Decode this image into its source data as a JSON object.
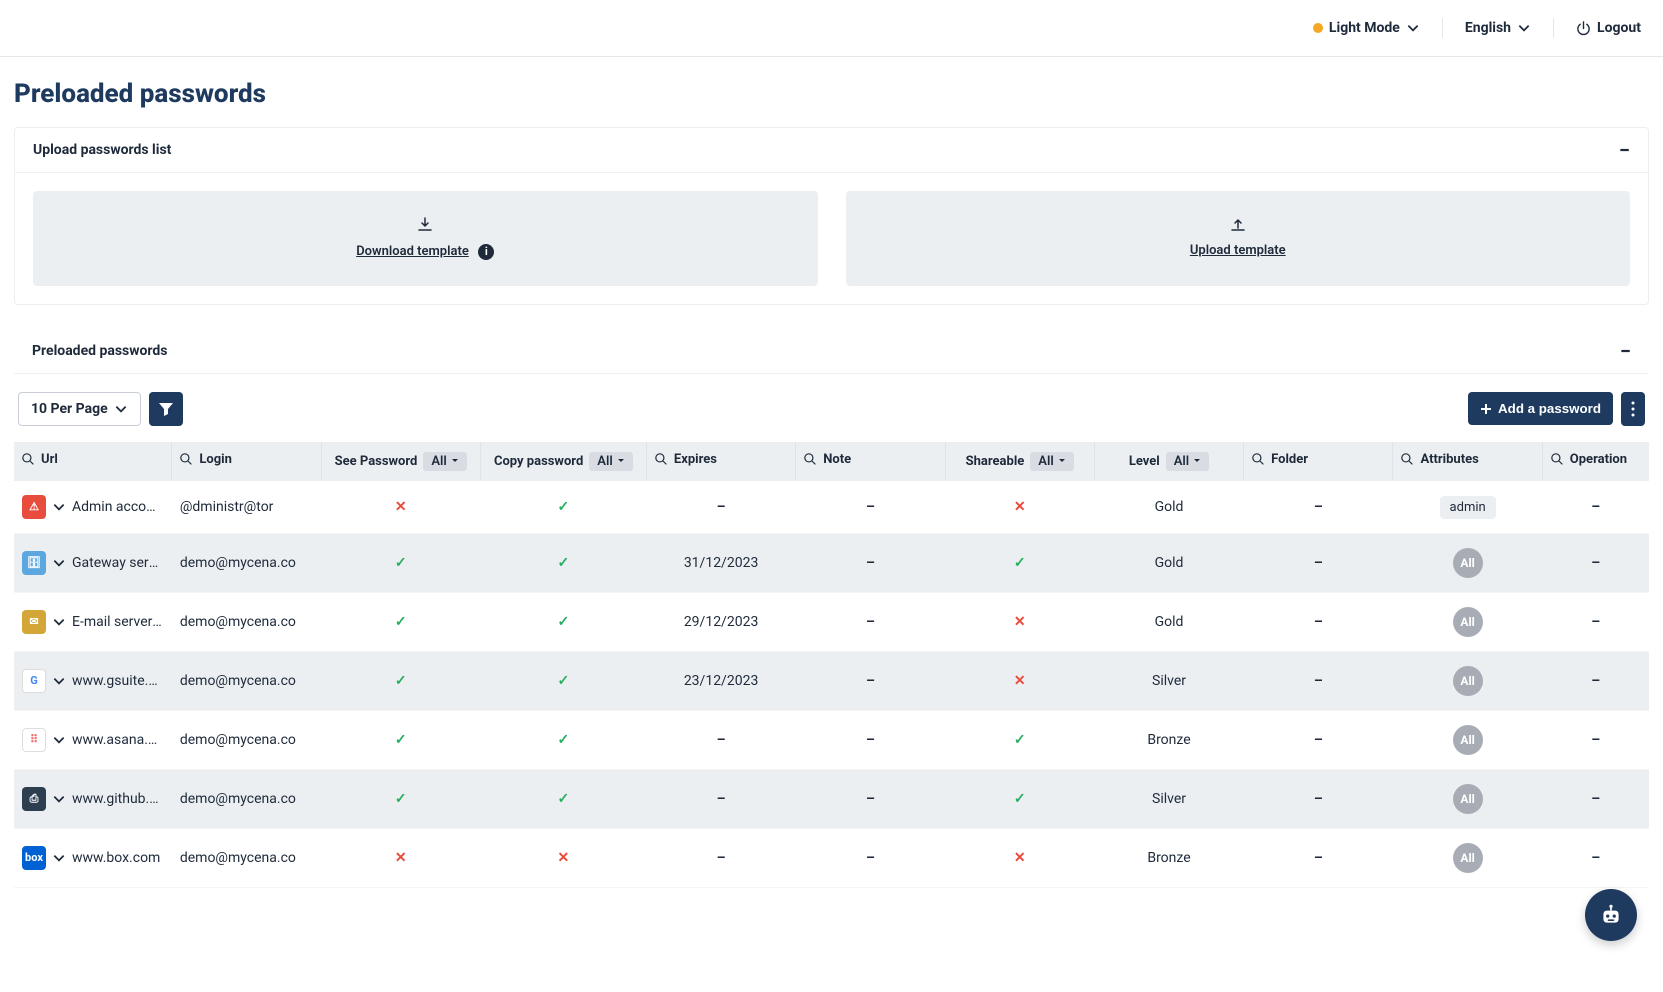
{
  "topbar": {
    "light_mode": "Light Mode",
    "language": "English",
    "logout": "Logout"
  },
  "page": {
    "title": "Preloaded passwords"
  },
  "upload_panel": {
    "title": "Upload passwords list",
    "download_template": "Download template",
    "upload_template": "Upload template"
  },
  "list_panel": {
    "title": "Preloaded passwords"
  },
  "toolbar": {
    "per_page": "10 Per Page",
    "add_password": "Add a password"
  },
  "columns": {
    "url": "Url",
    "login": "Login",
    "see_password": "See Password",
    "copy_password": "Copy password",
    "expires": "Expires",
    "note": "Note",
    "shareable": "Shareable",
    "level": "Level",
    "folder": "Folder",
    "attributes": "Attributes",
    "operation": "Operation",
    "filter_all": "All"
  },
  "rows": [
    {
      "icon_bg": "#e74c3c",
      "icon_txt": "⚠",
      "url": "Admin account.",
      "login": "@dministr@tor",
      "see": "no",
      "copy": "yes",
      "expires": "–",
      "note": "–",
      "shareable": "no",
      "level": "Gold",
      "folder": "–",
      "attr": "admin",
      "op": "–"
    },
    {
      "icon_bg": "#5da7e1",
      "icon_txt": "🗄",
      "url": "Gateway server",
      "login": "demo@mycena.co",
      "see": "yes",
      "copy": "yes",
      "expires": "31/12/2023",
      "note": "–",
      "shareable": "yes",
      "level": "Gold",
      "folder": "–",
      "attr": "All",
      "op": "–"
    },
    {
      "icon_bg": "#d4a637",
      "icon_txt": "✉",
      "url": "E-mail server pa",
      "login": "demo@mycena.co",
      "see": "yes",
      "copy": "yes",
      "expires": "29/12/2023",
      "note": "–",
      "shareable": "no",
      "level": "Gold",
      "folder": "–",
      "attr": "All",
      "op": "–"
    },
    {
      "icon_bg": "#ffffff",
      "icon_txt": "G",
      "url": "www.gsuite.goo",
      "login": "demo@mycena.co",
      "see": "yes",
      "copy": "yes",
      "expires": "23/12/2023",
      "note": "–",
      "shareable": "no",
      "level": "Silver",
      "folder": "–",
      "attr": "All",
      "op": "–"
    },
    {
      "icon_bg": "#ffffff",
      "icon_txt": "⠿",
      "url": "www.asana.com",
      "login": "demo@mycena.co",
      "see": "yes",
      "copy": "yes",
      "expires": "–",
      "note": "–",
      "shareable": "yes",
      "level": "Bronze",
      "folder": "–",
      "attr": "All",
      "op": "–"
    },
    {
      "icon_bg": "#2c3e50",
      "icon_txt": "⎙",
      "url": "www.github.cor",
      "login": "demo@mycena.co",
      "see": "yes",
      "copy": "yes",
      "expires": "–",
      "note": "–",
      "shareable": "yes",
      "level": "Silver",
      "folder": "–",
      "attr": "All",
      "op": "–"
    },
    {
      "icon_bg": "#0061d5",
      "icon_txt": "box",
      "url": "www.box.com",
      "login": "demo@mycena.co",
      "see": "no",
      "copy": "no",
      "expires": "–",
      "note": "–",
      "shareable": "no",
      "level": "Bronze",
      "folder": "–",
      "attr": "All",
      "op": "–"
    }
  ]
}
